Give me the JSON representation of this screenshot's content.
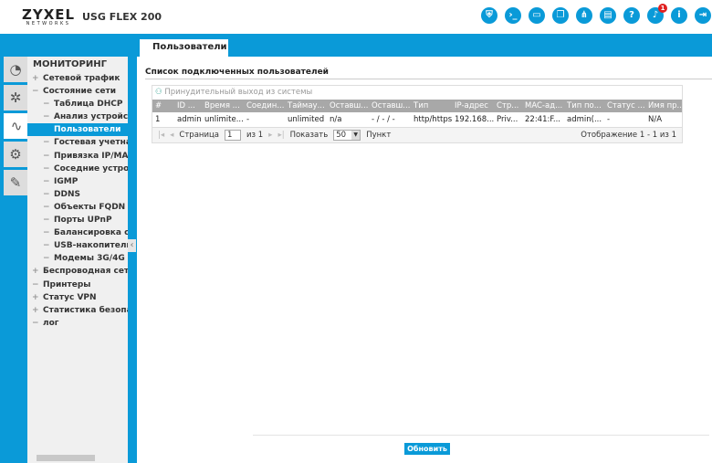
{
  "header": {
    "brand": "ZYXEL",
    "brand_sub": "NETWORKS",
    "model": "USG FLEX 200",
    "icons": [
      "shield-icon",
      "cli-icon",
      "console-icon",
      "windows-icon",
      "network-icon",
      "chat-icon",
      "help-icon",
      "bell-icon",
      "info-icon",
      "logout-icon"
    ],
    "notification_count": "1"
  },
  "left_tabs": [
    "dashboard-icon",
    "wizard-icon",
    "monitor-icon",
    "gear-icon",
    "tools-icon"
  ],
  "menu": {
    "title": "МОНИТОРИНГ",
    "items": [
      {
        "label": "Сетевой трафик",
        "level": 1,
        "sign": "+"
      },
      {
        "label": "Состояние сети",
        "level": 1,
        "sign": "−"
      },
      {
        "label": "Таблица DHCP",
        "level": 2,
        "sign": "−"
      },
      {
        "label": "Анализ устройств",
        "level": 2,
        "sign": "−"
      },
      {
        "label": "Пользователи",
        "level": 2,
        "sign": "−",
        "selected": true
      },
      {
        "label": "Гостевая учетная",
        "level": 2,
        "sign": "−"
      },
      {
        "label": "Привязка IP/MAC",
        "level": 2,
        "sign": "−"
      },
      {
        "label": "Соседние устройс",
        "level": 2,
        "sign": "−"
      },
      {
        "label": "IGMP",
        "level": 2,
        "sign": "−"
      },
      {
        "label": "DDNS",
        "level": 2,
        "sign": "−"
      },
      {
        "label": "Объекты FQDN",
        "level": 2,
        "sign": "−"
      },
      {
        "label": "Порты UPnP",
        "level": 2,
        "sign": "−"
      },
      {
        "label": "Балансировка сер",
        "level": 2,
        "sign": "−"
      },
      {
        "label": "USB-накопитель",
        "level": 2,
        "sign": "−"
      },
      {
        "label": "Модемы 3G/4G",
        "level": 2,
        "sign": "−"
      },
      {
        "label": "Беспроводная сеть",
        "level": 1,
        "sign": "+"
      },
      {
        "label": "Принтеры",
        "level": 1,
        "sign": "−"
      },
      {
        "label": "Статус VPN",
        "level": 1,
        "sign": "+"
      },
      {
        "label": "Статистика безопасн",
        "level": 1,
        "sign": "+"
      },
      {
        "label": "лог",
        "level": 1,
        "sign": "−"
      }
    ]
  },
  "main": {
    "tab": "Пользователи",
    "section_title": "Список подключенных пользователей",
    "force_logout": "Принудительный выход из системы",
    "columns": [
      "#",
      "ID ...",
      "Время ...",
      "Соедин...",
      "Таймау...",
      "Оставш...",
      "Оставш...",
      "Тип",
      "IP-адрес",
      "Стр...",
      "MAC-ад...",
      "Тип по...",
      "Статус ...",
      "Имя пр..."
    ],
    "rows": [
      [
        "1",
        "admin",
        "unlimite...",
        "-",
        "unlimited",
        "n/a",
        "- / - / -",
        "http/https",
        "192.168...",
        "Priv...",
        "22:41:F...",
        "admin(...",
        "-",
        "N/A"
      ]
    ],
    "pager": {
      "page_label": "Страница",
      "page": "1",
      "of": "из 1",
      "show_label": "Показать",
      "per_page": "50",
      "unit": "Пункт",
      "display": "Отображение 1 - 1 из 1"
    },
    "refresh": "Обновить"
  },
  "colors": {
    "accent": "#0a9ad8",
    "header_row": "#a8a8a8",
    "badge": "#e02020"
  }
}
